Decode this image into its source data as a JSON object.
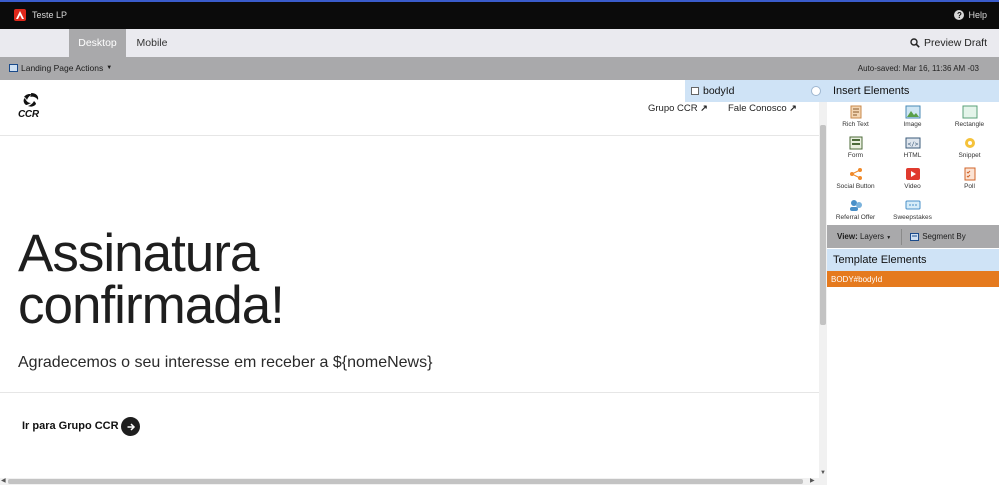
{
  "app": {
    "title": "Teste LP",
    "help_label": "Help"
  },
  "tabs": [
    {
      "label": "Desktop"
    },
    {
      "label": "Mobile"
    }
  ],
  "preview_label": "Preview Draft",
  "actions": {
    "landing_page_actions": "Landing Page Actions",
    "autosaved": "Auto-saved: Mar 16, 11:36 AM -03"
  },
  "page": {
    "logo_text": "CCR",
    "nav": [
      {
        "label": "Grupo CCR"
      },
      {
        "label": "Fale Conosco"
      }
    ],
    "hero_title_line1": "Assinatura",
    "hero_title_line2": "confirmada!",
    "hero_subtitle": "Agradecemos o seu interesse em receber a ${nomeNews}",
    "cta_label": "Ir para Grupo CCR"
  },
  "overlay": {
    "body_id": "bodyId"
  },
  "panel": {
    "insert_title": "Insert Elements",
    "elements": [
      {
        "label": "Rich Text",
        "icon": "rich-text-icon"
      },
      {
        "label": "Image",
        "icon": "image-icon"
      },
      {
        "label": "Rectangle",
        "icon": "rectangle-icon"
      },
      {
        "label": "Form",
        "icon": "form-icon"
      },
      {
        "label": "HTML",
        "icon": "html-icon"
      },
      {
        "label": "Snippet",
        "icon": "snippet-icon"
      },
      {
        "label": "Social Button",
        "icon": "social-button-icon"
      },
      {
        "label": "Video",
        "icon": "video-icon"
      },
      {
        "label": "Poll",
        "icon": "poll-icon"
      },
      {
        "label": "Referral Offer",
        "icon": "referral-offer-icon"
      },
      {
        "label": "Sweepstakes",
        "icon": "sweepstakes-icon"
      }
    ],
    "view_label": "View:",
    "view_value": "Layers",
    "segment_label": "Segment By",
    "template_title": "Template Elements",
    "template_item": "BODY#bodyId"
  },
  "colors": {
    "accent_orange": "#e57a1e",
    "panel_header": "#cfe3f6",
    "toolbar_gray": "#a9a9ab"
  }
}
